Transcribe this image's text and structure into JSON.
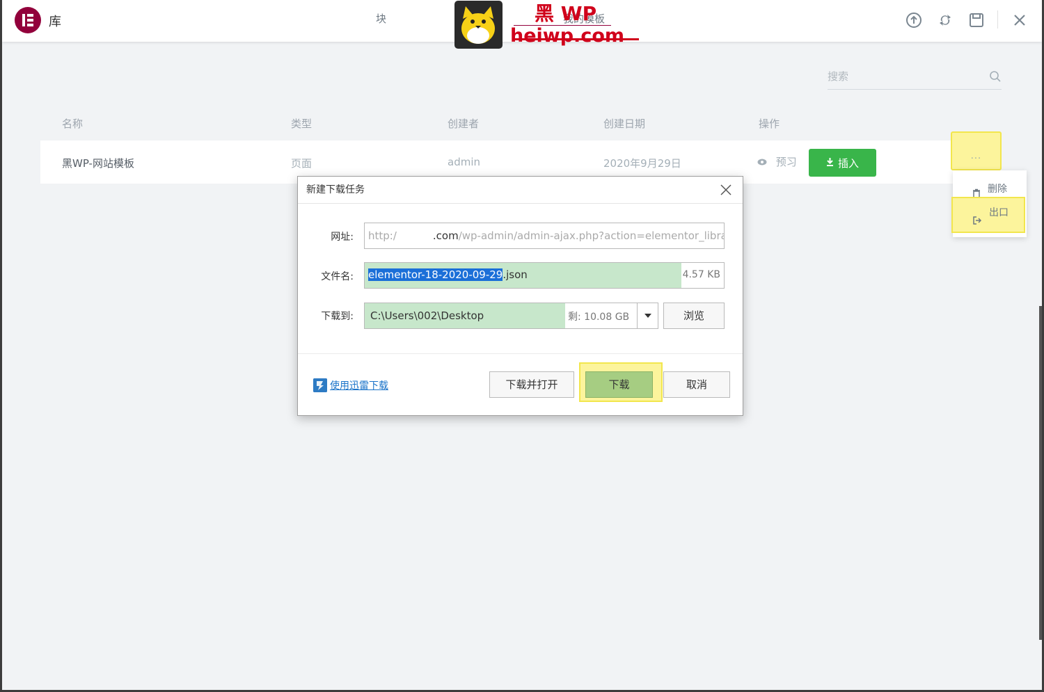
{
  "header": {
    "title": "库",
    "tabs": [
      {
        "label": "块"
      },
      {
        "label": "我的模板"
      }
    ],
    "icons": [
      "upload-icon",
      "sync-icon",
      "save-icon",
      "close-icon"
    ]
  },
  "watermark": {
    "cn": "黑 WP",
    "url": "heiwp.com"
  },
  "search": {
    "placeholder": "搜索"
  },
  "table": {
    "headers": [
      "名称",
      "类型",
      "创建者",
      "创建日期",
      "操作"
    ],
    "rows": [
      {
        "name": "黑WP-网站模板",
        "type": "页面",
        "author": "admin",
        "date": "2020年9月29日",
        "preview": "预习",
        "insert": "插入",
        "more": "..."
      }
    ]
  },
  "context_menu": {
    "delete": "删除",
    "export": "出口"
  },
  "dialog": {
    "title": "新建下载任务",
    "url_label": "网址:",
    "url_prefix": "http:/",
    "url_domain_tail": ".com",
    "url_rest": "/wp-admin/admin-ajax.php?action=elementor_libra",
    "filename_label": "文件名:",
    "filename_selected": "elementor-18-2020-09-29",
    "filename_ext": ".json",
    "filesize": "4.57 KB",
    "saveto_label": "下载到:",
    "saveto_path": "C:\\Users\\002\\Desktop",
    "free_space": "剩: 10.08 GB",
    "browse": "浏览",
    "thunder_link": "使用迅雷下载",
    "download_open": "下载并打开",
    "download": "下载",
    "cancel": "取消"
  },
  "colors": {
    "brand": "#92003b",
    "insert": "#39b54a",
    "highlight": "#fcf49c",
    "download_btn": "#a6cd82",
    "link": "#1a73c9"
  }
}
